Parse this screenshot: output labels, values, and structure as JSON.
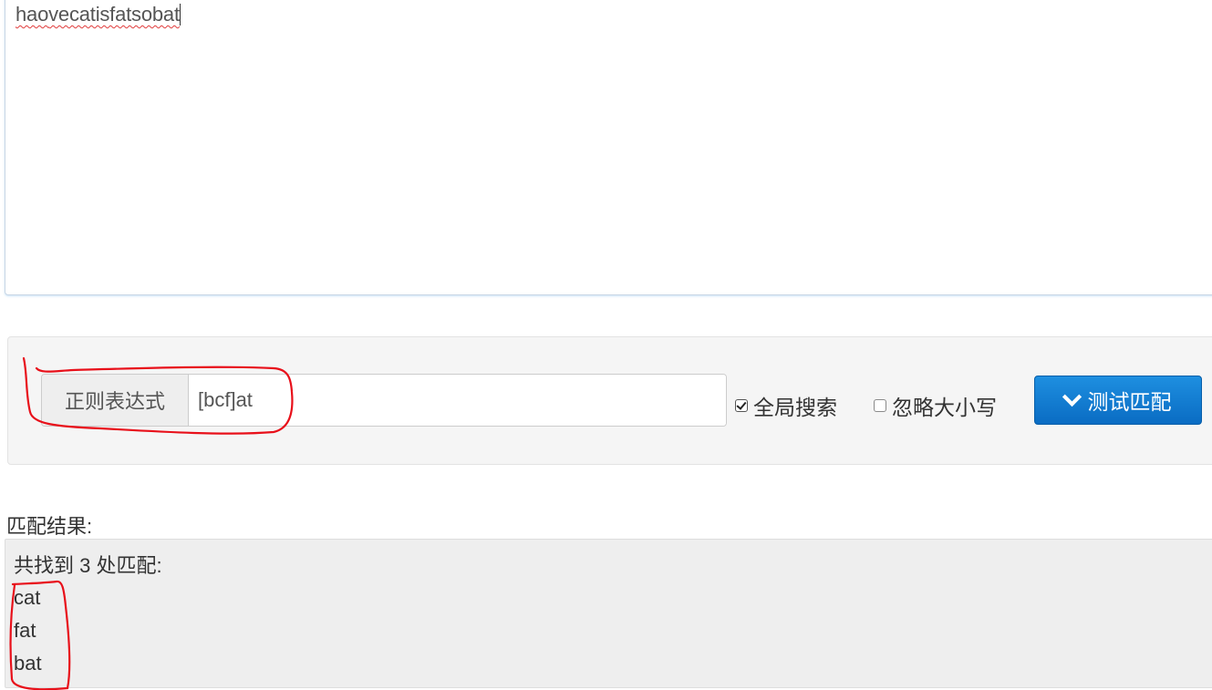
{
  "source": {
    "text_parts": [
      "hao",
      "vecatisfatsobat"
    ]
  },
  "regex_bar": {
    "addon_label": "正则表达式",
    "pattern_value": "[bcf]at",
    "global_label": "全局搜索",
    "global_checked": true,
    "ignore_case_label": "忽略大小写",
    "ignore_case_checked": false,
    "test_button_label": "测试匹配",
    "test_button_icon": "chevron-down-icon"
  },
  "result": {
    "label": "匹配结果:",
    "summary": "共找到 3 处匹配:",
    "matches": [
      "cat",
      "fat",
      "bat"
    ]
  },
  "colors": {
    "button_blue": "#0a6cc3",
    "annotation_red": "#e8101a",
    "well_bg": "#f5f5f5",
    "result_bg": "#eeeeee"
  }
}
